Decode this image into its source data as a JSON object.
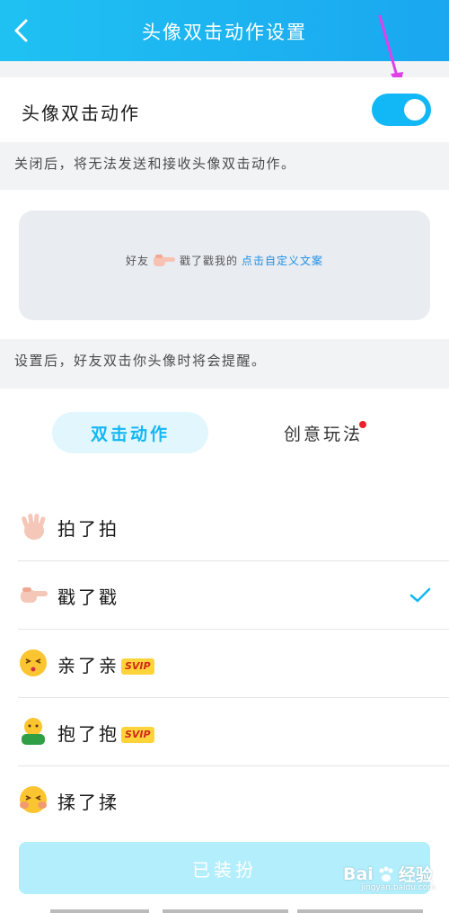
{
  "header": {
    "title": "头像双击动作设置"
  },
  "toggle": {
    "label": "头像双击动作",
    "state": "on"
  },
  "notes": {
    "toggle_note": "关闭后，将无法发送和接收头像双击动作。",
    "preview_note": "设置后，好友双击你头像时将会提醒。"
  },
  "preview": {
    "prefix": "好友",
    "middle": "戳了戳我的",
    "link": "点击自定义文案"
  },
  "tabs": [
    {
      "label": "双击动作",
      "active": true
    },
    {
      "label": "创意玩法",
      "active": false,
      "badge": "red-dot"
    }
  ],
  "actions": [
    {
      "label": "拍了拍",
      "icon": "wave-hand-icon",
      "svip": false,
      "selected": false
    },
    {
      "label": "戳了戳",
      "icon": "pointing-finger-icon",
      "svip": false,
      "selected": true
    },
    {
      "label": "亲了亲",
      "icon": "kiss-face-icon",
      "svip": true,
      "selected": false
    },
    {
      "label": "抱了抱",
      "icon": "hug-face-icon",
      "svip": true,
      "selected": false
    },
    {
      "label": "揉了揉",
      "icon": "blush-face-icon",
      "svip": false,
      "selected": false
    }
  ],
  "svip_label": "SVIP",
  "equip_button": "已装扮",
  "watermark": {
    "brand": "Bai",
    "brand2": "经验",
    "sub": "jingyan.baidu.com"
  },
  "colors": {
    "accent": "#12b7f5",
    "header": "#1aa7f0",
    "svip_bg": "#ffd43a",
    "annotation_arrow": "#e040e8"
  }
}
